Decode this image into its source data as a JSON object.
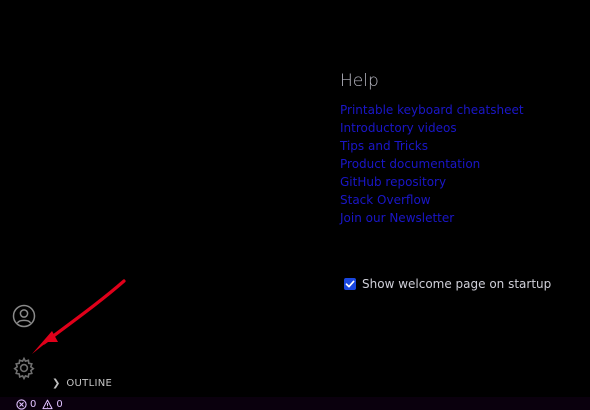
{
  "help": {
    "title": "Help",
    "links": [
      "Printable keyboard cheatsheet",
      "Introductory videos",
      "Tips and Tricks",
      "Product documentation",
      "GitHub repository",
      "Stack Overflow",
      "Join our Newsletter"
    ]
  },
  "startup": {
    "checked": true,
    "label": "Show welcome page on startup"
  },
  "activity_bar": {
    "icons": [
      "account-icon",
      "gear-icon"
    ]
  },
  "sidebar": {
    "outline_label": "OUTLINE"
  },
  "status_bar": {
    "errors": "0",
    "warnings": "0"
  },
  "colors": {
    "background": "#000000",
    "link": "#1a16c8",
    "checkbox": "#1a47e0",
    "annotation_arrow": "#e0001a"
  }
}
